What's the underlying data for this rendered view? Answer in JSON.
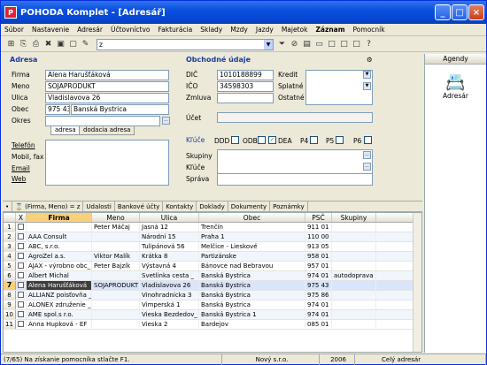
{
  "title": "POHODA Komplet - [Adresář]",
  "menu": [
    "Súbor",
    "Nastavenie",
    "Adresár",
    "Účtovníctvo",
    "Fakturácia",
    "Sklady",
    "Mzdy",
    "Jazdy",
    "Majetok",
    "Záznam",
    "Pomocník"
  ],
  "toolbar": {
    "filter_value": "z"
  },
  "adresa": {
    "section_title": "Adresa",
    "firma_label": "Firma",
    "firma": "Alena Harušťáková",
    "meno_label": "Meno",
    "meno": "SOJAPRODUKT",
    "ulica_label": "Ulica",
    "ulica": "Vladislavova 26",
    "obec_label": "Obec",
    "psc": "975 43",
    "obec": "Banská Bystrica",
    "okres_label": "Okres",
    "tab_adresa": "adresa",
    "tab_dodacia": "dodacia adresa",
    "telefon_label": "Telefón",
    "mobil_label": "Mobil, fax",
    "email_label": "Email",
    "web_label": "Web"
  },
  "obchodne": {
    "section_title": "Obchodné údaje",
    "dic_label": "DIČ",
    "dic": "1010188899",
    "ico_label": "IČO",
    "ico": "34598303",
    "zmluva_label": "Zmluva",
    "kredit_label": "Kredit",
    "splatne_label": "Splatné",
    "ostatne_label": "Ostatné",
    "ucet_label": "Účet",
    "kluce_label": "Kľúče",
    "checkboxes": [
      {
        "label": "DDD",
        "checked": false
      },
      {
        "label": "ODB",
        "checked": false
      },
      {
        "label": "DEA",
        "checked": true
      },
      {
        "label": "P4",
        "checked": false
      },
      {
        "label": "P5",
        "checked": false
      },
      {
        "label": "P6",
        "checked": false
      }
    ],
    "skupiny_label": "Skupiny",
    "kluce2_label": "Kľúče",
    "sprava_label": "Správa"
  },
  "agenda": {
    "header": "Agendy",
    "item": "Adresár"
  },
  "bottom_tabs": [
    "(Firma, Meno) = z",
    "Udalosti",
    "Bankové účty",
    "Kontakty",
    "Doklady",
    "Dokumenty",
    "Poznámky"
  ],
  "grid": {
    "headers": [
      "",
      "X",
      "Firma",
      "Meno",
      "Ulica",
      "Obec",
      "PSČ",
      "Skupiny"
    ],
    "rows": [
      {
        "n": "1",
        "firma": "",
        "meno": "Peter Máčaj",
        "ulica": "Jasná 12",
        "obec": "Trenčín",
        "psc": "911 01",
        "skupiny": ""
      },
      {
        "n": "2",
        "firma": "AAA Consult",
        "meno": "",
        "ulica": "Národní 15",
        "obec": "Praha 1",
        "psc": "110 00",
        "skupiny": ""
      },
      {
        "n": "3",
        "firma": "ABC, s.r.o.",
        "meno": "",
        "ulica": "Tulipánová 56",
        "obec": "Melčice - Lieskové",
        "psc": "913 05",
        "skupiny": ""
      },
      {
        "n": "4",
        "firma": "AgroZel a.s.",
        "meno": "Viktor Malík",
        "ulica": "Krátka 8",
        "obec": "Partizánske",
        "psc": "958 01",
        "skupiny": ""
      },
      {
        "n": "5",
        "firma": "AJAX - výrobno obc_",
        "meno": "Peter Bajzík",
        "ulica": "Výstavná 4",
        "obec": "Bánovce nad Bebravou",
        "psc": "957 01",
        "skupiny": ""
      },
      {
        "n": "6",
        "firma": "Albert Michal",
        "meno": "",
        "ulica": "Svetlinka cesta _",
        "obec": "Banská Bystrica",
        "psc": "974 01",
        "skupiny": "autodoprava"
      },
      {
        "n": "7",
        "firma": "Alena Harušťáková",
        "meno": "SOJAPRODUKT",
        "ulica": "Vladislavova 26",
        "obec": "Banská Bystrica",
        "psc": "975 43",
        "skupiny": ""
      },
      {
        "n": "8",
        "firma": "ALLIANZ poisťovňa _",
        "meno": "",
        "ulica": "Vinohradnícka 3",
        "obec": "Banská Bystrica",
        "psc": "975 86",
        "skupiny": ""
      },
      {
        "n": "9",
        "firma": "ALONEX združenie _",
        "meno": "",
        "ulica": "Vimperská 1",
        "obec": "Banská Bystrica",
        "psc": "974 01",
        "skupiny": ""
      },
      {
        "n": "10",
        "firma": "AME spol.s r.o.",
        "meno": "",
        "ulica": "Vieska Bezdedov_",
        "obec": "Banská Bystrica 1",
        "psc": "974 01",
        "skupiny": ""
      },
      {
        "n": "11",
        "firma": "Anna Hupková - EF",
        "meno": "",
        "ulica": "Vieska 2",
        "obec": "Bardejov",
        "psc": "085 01",
        "skupiny": ""
      }
    ],
    "selected_row": 6
  },
  "status": {
    "hint": "(7/65) Na získanie pomocníka stlačte F1.",
    "company": "Nový s.r.o.",
    "year": "2006",
    "view": "Celý adresár"
  }
}
